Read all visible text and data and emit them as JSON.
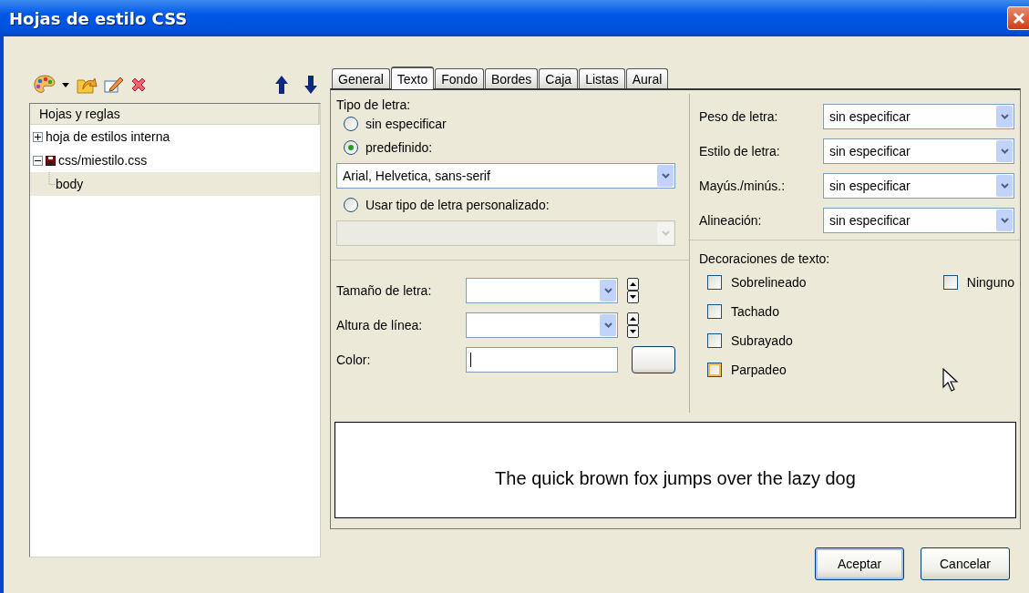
{
  "window": {
    "title": "Hojas de estilo CSS"
  },
  "tree": {
    "header": "Hojas y reglas",
    "items": [
      {
        "label": "hoja de estilos interna",
        "kind": "sheet",
        "expanded": false,
        "selected": false
      },
      {
        "label": "css/miestilo.css",
        "kind": "file",
        "expanded": true,
        "selected": false,
        "children": [
          {
            "label": "body",
            "selected": true
          }
        ]
      }
    ]
  },
  "tabs": [
    {
      "label": "General",
      "selected": false
    },
    {
      "label": "Texto",
      "selected": true
    },
    {
      "label": "Fondo",
      "selected": false
    },
    {
      "label": "Bordes",
      "selected": false
    },
    {
      "label": "Caja",
      "selected": false
    },
    {
      "label": "Listas",
      "selected": false
    },
    {
      "label": "Aural",
      "selected": false
    }
  ],
  "font_family": {
    "label": "Tipo de letra:",
    "choices": [
      {
        "kind": "radio",
        "label": "sin especificar",
        "selected": false
      },
      {
        "kind": "radio",
        "label": "predefinido:",
        "selected": true
      },
      {
        "kind": "select",
        "value": "Arial, Helvetica, sans-serif",
        "disabled": false
      },
      {
        "kind": "radio",
        "label": "Usar tipo de letra personalizado:",
        "selected": false
      },
      {
        "kind": "select",
        "disabled": true
      }
    ]
  },
  "size_fields": [
    {
      "kind": "spin",
      "label": "Tamaño de letra:"
    },
    {
      "kind": "spin",
      "label": "Altura de línea:"
    },
    {
      "kind": "color",
      "label": "Color:"
    }
  ],
  "properties": [
    {
      "label": "Peso de letra:",
      "value": "sin especificar"
    },
    {
      "label": "Estilo de letra:",
      "value": "sin especificar"
    },
    {
      "label": "Mayús./minús.:",
      "value": "sin especificar"
    },
    {
      "label": "Alineación:",
      "value": "sin especificar"
    }
  ],
  "decorations": {
    "label": "Decoraciones de texto:",
    "items": [
      {
        "label": "Sobrelineado",
        "checked": false,
        "hovered": false
      },
      {
        "label": "Tachado",
        "checked": false,
        "hovered": false
      },
      {
        "label": "Subrayado",
        "checked": false,
        "hovered": false
      },
      {
        "label": "Parpadeo",
        "checked": false,
        "hovered": true
      }
    ],
    "none_option": {
      "label": "Ninguno",
      "checked": false,
      "hovered": false
    }
  },
  "preview": {
    "text": "The quick brown fox jumps over the lazy dog"
  },
  "buttons": [
    {
      "label": "Aceptar",
      "default": true
    },
    {
      "label": "Cancelar",
      "default": false
    }
  ]
}
